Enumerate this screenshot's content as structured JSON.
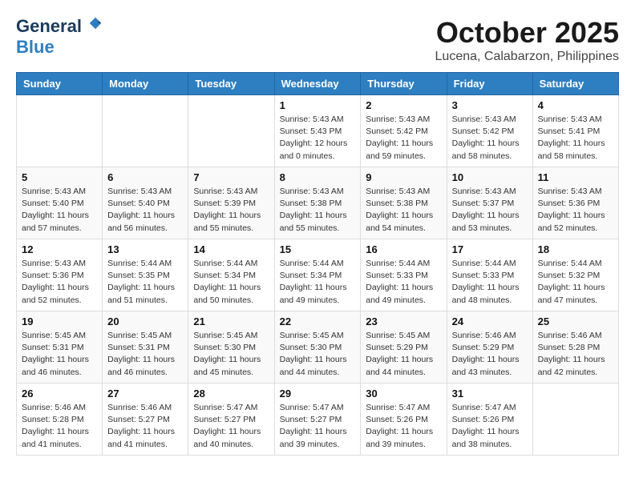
{
  "header": {
    "logo_general": "General",
    "logo_blue": "Blue",
    "month": "October 2025",
    "location": "Lucena, Calabarzon, Philippines"
  },
  "days_of_week": [
    "Sunday",
    "Monday",
    "Tuesday",
    "Wednesday",
    "Thursday",
    "Friday",
    "Saturday"
  ],
  "weeks": [
    [
      {
        "day": "",
        "sunrise": "",
        "sunset": "",
        "daylight": ""
      },
      {
        "day": "",
        "sunrise": "",
        "sunset": "",
        "daylight": ""
      },
      {
        "day": "",
        "sunrise": "",
        "sunset": "",
        "daylight": ""
      },
      {
        "day": "1",
        "sunrise": "Sunrise: 5:43 AM",
        "sunset": "Sunset: 5:43 PM",
        "daylight": "Daylight: 12 hours and 0 minutes."
      },
      {
        "day": "2",
        "sunrise": "Sunrise: 5:43 AM",
        "sunset": "Sunset: 5:42 PM",
        "daylight": "Daylight: 11 hours and 59 minutes."
      },
      {
        "day": "3",
        "sunrise": "Sunrise: 5:43 AM",
        "sunset": "Sunset: 5:42 PM",
        "daylight": "Daylight: 11 hours and 58 minutes."
      },
      {
        "day": "4",
        "sunrise": "Sunrise: 5:43 AM",
        "sunset": "Sunset: 5:41 PM",
        "daylight": "Daylight: 11 hours and 58 minutes."
      }
    ],
    [
      {
        "day": "5",
        "sunrise": "Sunrise: 5:43 AM",
        "sunset": "Sunset: 5:40 PM",
        "daylight": "Daylight: 11 hours and 57 minutes."
      },
      {
        "day": "6",
        "sunrise": "Sunrise: 5:43 AM",
        "sunset": "Sunset: 5:40 PM",
        "daylight": "Daylight: 11 hours and 56 minutes."
      },
      {
        "day": "7",
        "sunrise": "Sunrise: 5:43 AM",
        "sunset": "Sunset: 5:39 PM",
        "daylight": "Daylight: 11 hours and 55 minutes."
      },
      {
        "day": "8",
        "sunrise": "Sunrise: 5:43 AM",
        "sunset": "Sunset: 5:38 PM",
        "daylight": "Daylight: 11 hours and 55 minutes."
      },
      {
        "day": "9",
        "sunrise": "Sunrise: 5:43 AM",
        "sunset": "Sunset: 5:38 PM",
        "daylight": "Daylight: 11 hours and 54 minutes."
      },
      {
        "day": "10",
        "sunrise": "Sunrise: 5:43 AM",
        "sunset": "Sunset: 5:37 PM",
        "daylight": "Daylight: 11 hours and 53 minutes."
      },
      {
        "day": "11",
        "sunrise": "Sunrise: 5:43 AM",
        "sunset": "Sunset: 5:36 PM",
        "daylight": "Daylight: 11 hours and 52 minutes."
      }
    ],
    [
      {
        "day": "12",
        "sunrise": "Sunrise: 5:43 AM",
        "sunset": "Sunset: 5:36 PM",
        "daylight": "Daylight: 11 hours and 52 minutes."
      },
      {
        "day": "13",
        "sunrise": "Sunrise: 5:44 AM",
        "sunset": "Sunset: 5:35 PM",
        "daylight": "Daylight: 11 hours and 51 minutes."
      },
      {
        "day": "14",
        "sunrise": "Sunrise: 5:44 AM",
        "sunset": "Sunset: 5:34 PM",
        "daylight": "Daylight: 11 hours and 50 minutes."
      },
      {
        "day": "15",
        "sunrise": "Sunrise: 5:44 AM",
        "sunset": "Sunset: 5:34 PM",
        "daylight": "Daylight: 11 hours and 49 minutes."
      },
      {
        "day": "16",
        "sunrise": "Sunrise: 5:44 AM",
        "sunset": "Sunset: 5:33 PM",
        "daylight": "Daylight: 11 hours and 49 minutes."
      },
      {
        "day": "17",
        "sunrise": "Sunrise: 5:44 AM",
        "sunset": "Sunset: 5:33 PM",
        "daylight": "Daylight: 11 hours and 48 minutes."
      },
      {
        "day": "18",
        "sunrise": "Sunrise: 5:44 AM",
        "sunset": "Sunset: 5:32 PM",
        "daylight": "Daylight: 11 hours and 47 minutes."
      }
    ],
    [
      {
        "day": "19",
        "sunrise": "Sunrise: 5:45 AM",
        "sunset": "Sunset: 5:31 PM",
        "daylight": "Daylight: 11 hours and 46 minutes."
      },
      {
        "day": "20",
        "sunrise": "Sunrise: 5:45 AM",
        "sunset": "Sunset: 5:31 PM",
        "daylight": "Daylight: 11 hours and 46 minutes."
      },
      {
        "day": "21",
        "sunrise": "Sunrise: 5:45 AM",
        "sunset": "Sunset: 5:30 PM",
        "daylight": "Daylight: 11 hours and 45 minutes."
      },
      {
        "day": "22",
        "sunrise": "Sunrise: 5:45 AM",
        "sunset": "Sunset: 5:30 PM",
        "daylight": "Daylight: 11 hours and 44 minutes."
      },
      {
        "day": "23",
        "sunrise": "Sunrise: 5:45 AM",
        "sunset": "Sunset: 5:29 PM",
        "daylight": "Daylight: 11 hours and 44 minutes."
      },
      {
        "day": "24",
        "sunrise": "Sunrise: 5:46 AM",
        "sunset": "Sunset: 5:29 PM",
        "daylight": "Daylight: 11 hours and 43 minutes."
      },
      {
        "day": "25",
        "sunrise": "Sunrise: 5:46 AM",
        "sunset": "Sunset: 5:28 PM",
        "daylight": "Daylight: 11 hours and 42 minutes."
      }
    ],
    [
      {
        "day": "26",
        "sunrise": "Sunrise: 5:46 AM",
        "sunset": "Sunset: 5:28 PM",
        "daylight": "Daylight: 11 hours and 41 minutes."
      },
      {
        "day": "27",
        "sunrise": "Sunrise: 5:46 AM",
        "sunset": "Sunset: 5:27 PM",
        "daylight": "Daylight: 11 hours and 41 minutes."
      },
      {
        "day": "28",
        "sunrise": "Sunrise: 5:47 AM",
        "sunset": "Sunset: 5:27 PM",
        "daylight": "Daylight: 11 hours and 40 minutes."
      },
      {
        "day": "29",
        "sunrise": "Sunrise: 5:47 AM",
        "sunset": "Sunset: 5:27 PM",
        "daylight": "Daylight: 11 hours and 39 minutes."
      },
      {
        "day": "30",
        "sunrise": "Sunrise: 5:47 AM",
        "sunset": "Sunset: 5:26 PM",
        "daylight": "Daylight: 11 hours and 39 minutes."
      },
      {
        "day": "31",
        "sunrise": "Sunrise: 5:47 AM",
        "sunset": "Sunset: 5:26 PM",
        "daylight": "Daylight: 11 hours and 38 minutes."
      },
      {
        "day": "",
        "sunrise": "",
        "sunset": "",
        "daylight": ""
      }
    ]
  ]
}
